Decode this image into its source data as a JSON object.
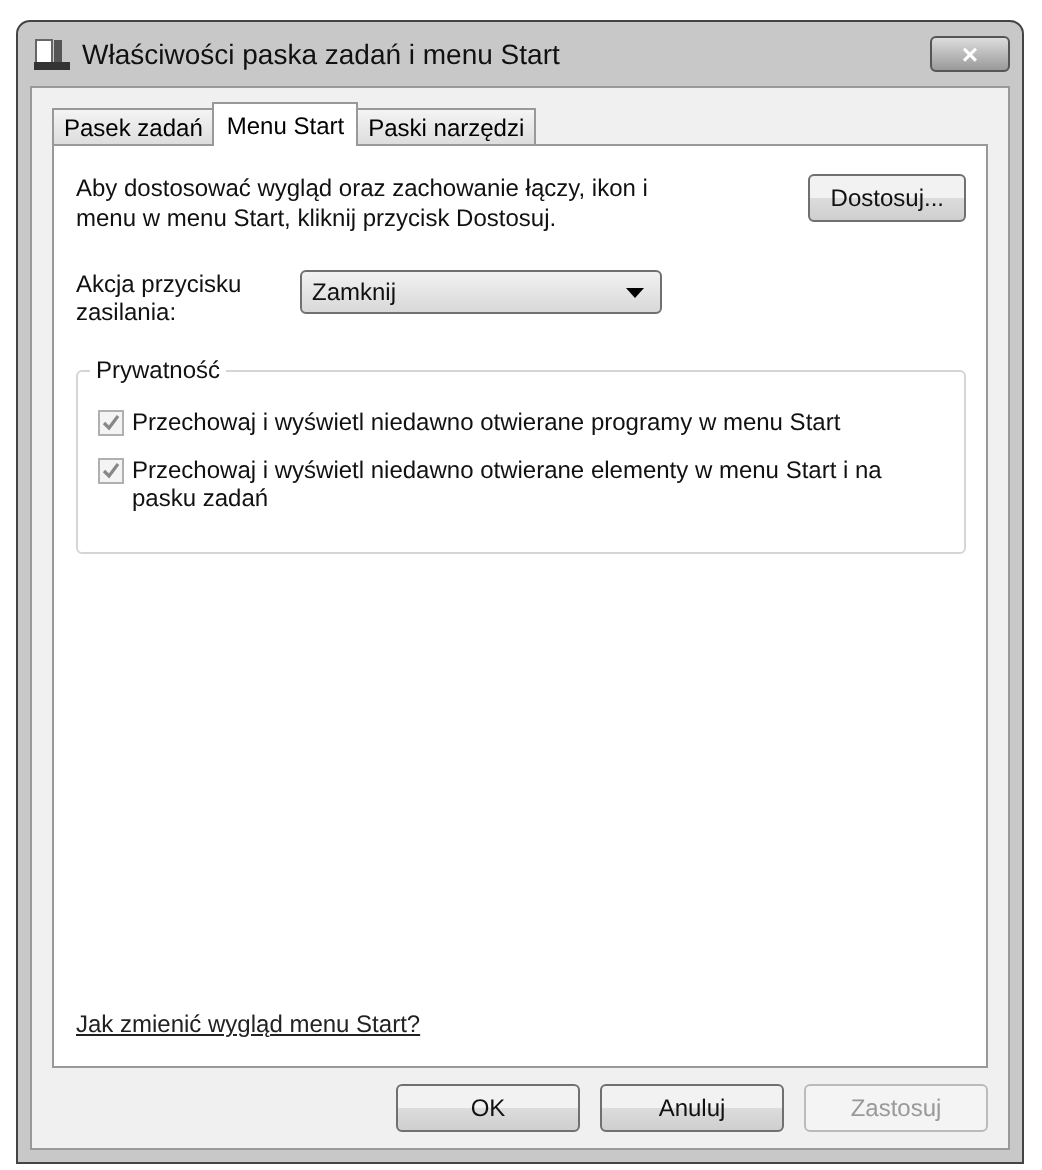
{
  "window": {
    "title": "Właściwości paska zadań i menu Start",
    "close": "×"
  },
  "tabs": [
    {
      "label": "Pasek zadań",
      "selected": false
    },
    {
      "label": "Menu Start",
      "selected": true
    },
    {
      "label": "Paski narzędzi",
      "selected": false
    }
  ],
  "intro": {
    "text": "Aby dostosować wygląd oraz zachowanie łączy, ikon i menu w menu Start, kliknij przycisk Dostosuj.",
    "button": "Dostosuj..."
  },
  "power_action": {
    "label": "Akcja przycisku zasilania:",
    "value": "Zamknij"
  },
  "privacy": {
    "title": "Prywatność",
    "options": [
      {
        "label": "Przechowaj i wyświetl niedawno otwierane programy w menu Start",
        "checked": true,
        "disabled": true
      },
      {
        "label": "Przechowaj i wyświetl niedawno otwierane elementy w menu Start i na pasku zadań",
        "checked": true,
        "disabled": true
      }
    ]
  },
  "help_link": "Jak zmienić wygląd menu Start?",
  "buttons": [
    {
      "label": "OK",
      "disabled": false
    },
    {
      "label": "Anuluj",
      "disabled": false
    },
    {
      "label": "Zastosuj",
      "disabled": true
    }
  ]
}
